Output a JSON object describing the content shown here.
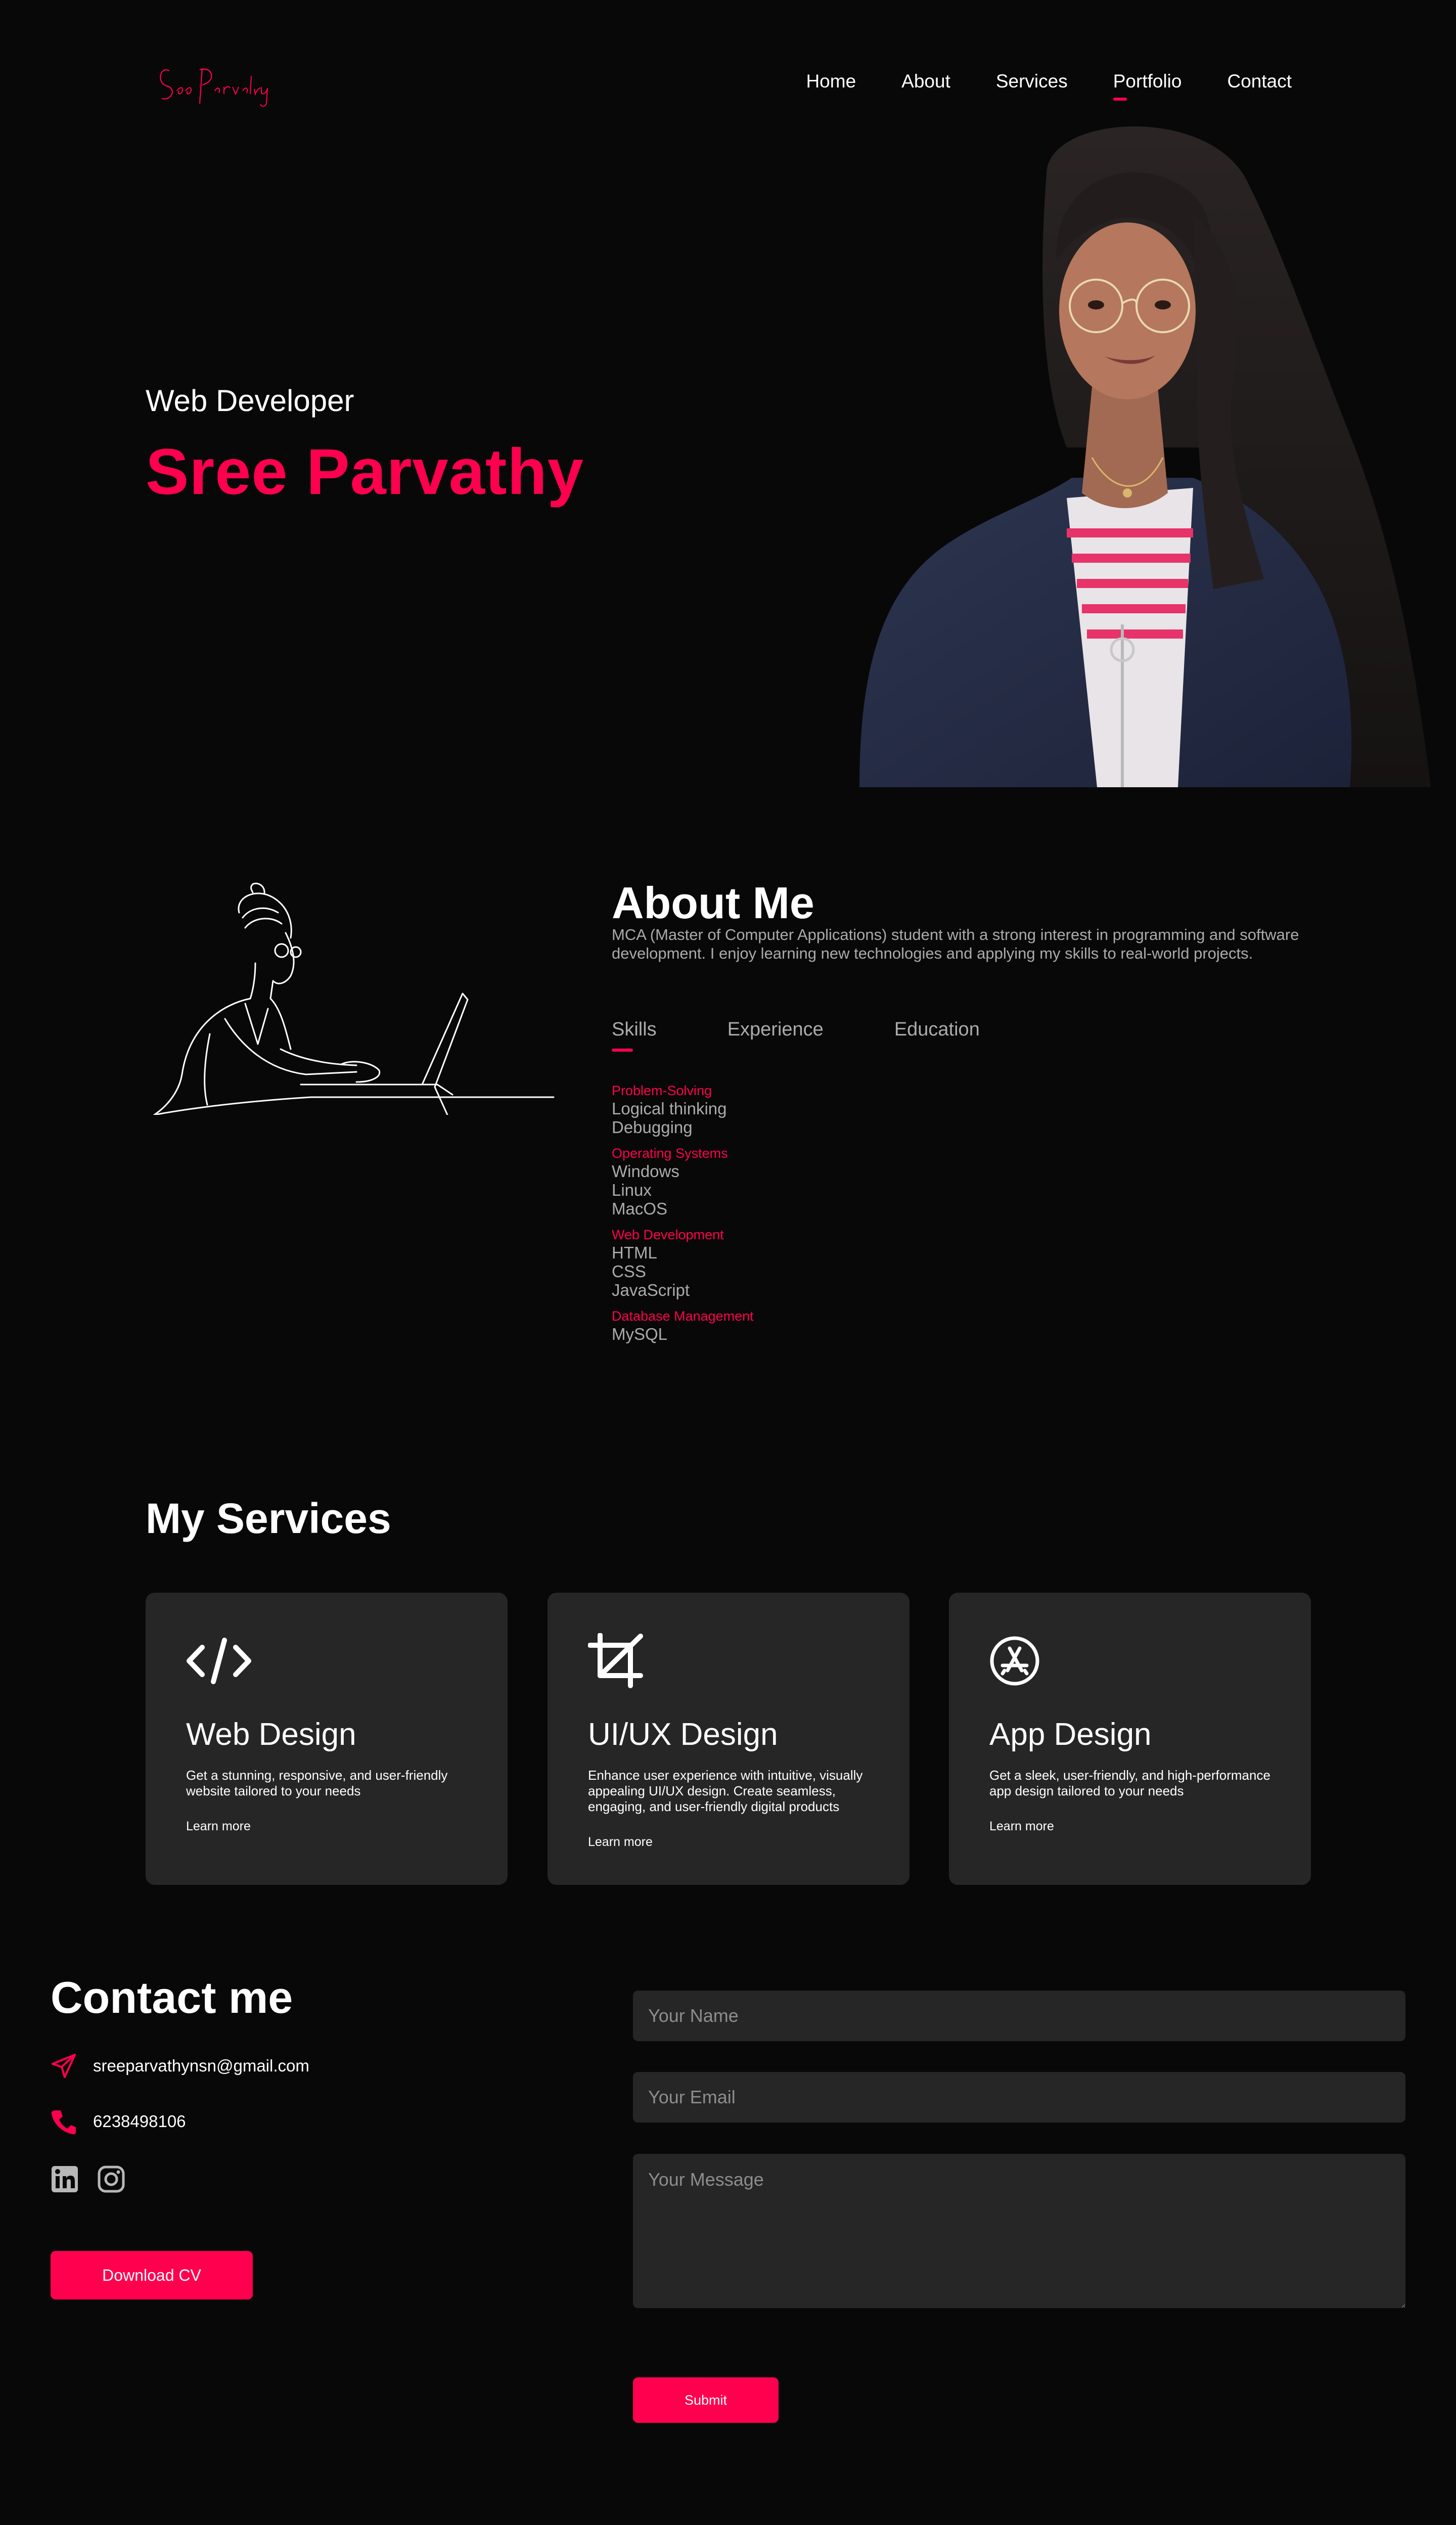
{
  "brand": {
    "logo_text": "Sree Parvathy",
    "accent": "#ff004f",
    "bg": "#080808",
    "card_bg": "#262626"
  },
  "nav": {
    "items": [
      {
        "label": "Home"
      },
      {
        "label": "About"
      },
      {
        "label": "Services"
      },
      {
        "label": "Portfolio",
        "active": true
      },
      {
        "label": "Contact"
      }
    ]
  },
  "hero": {
    "role": "Web Developer",
    "name": "Sree Parvathy",
    "portrait_icon": "portrait-photo"
  },
  "about": {
    "title": "About Me",
    "text": "MCA (Master of Computer Applications) student with a strong interest in programming and software development. I enjoy learning new technologies and applying my skills to real-world projects.",
    "illustration_icon": "woman-at-laptop-line-art",
    "tabs": [
      {
        "label": "Skills",
        "active": true
      },
      {
        "label": "Experience"
      },
      {
        "label": "Education"
      }
    ],
    "skills": [
      {
        "category": "Problem-Solving",
        "items": [
          "Logical thinking",
          "Debugging"
        ]
      },
      {
        "category": "Operating Systems",
        "items": [
          "Windows",
          "Linux",
          "MacOS"
        ]
      },
      {
        "category": "Web Development",
        "items": [
          "HTML",
          "CSS",
          "JavaScript"
        ]
      },
      {
        "category": "Database Management",
        "items": [
          "MySQL"
        ]
      }
    ]
  },
  "services": {
    "title": "My Services",
    "cards": [
      {
        "icon": "code-icon",
        "title": "Web Design",
        "text": "Get a stunning, responsive, and user-friendly website tailored to your needs",
        "link": "Learn more"
      },
      {
        "icon": "crop-icon",
        "title": "UI/UX Design",
        "text": "Enhance user experience with intuitive, visually appealing UI/UX design. Create seamless, engaging, and user-friendly digital products",
        "link": "Learn more"
      },
      {
        "icon": "app-store-icon",
        "title": "App Design",
        "text": "Get a sleek, user-friendly, and high-performance app design tailored to your needs",
        "link": "Learn more"
      }
    ]
  },
  "contact": {
    "title": "Contact me",
    "email": "sreeparvathynsn@gmail.com",
    "phone": "6238498106",
    "social": [
      "linkedin-icon",
      "instagram-icon"
    ],
    "cv_button": "Download CV",
    "form": {
      "name_placeholder": "Your Name",
      "email_placeholder": "Your Email",
      "message_placeholder": "Your Message",
      "submit_label": "Submit"
    }
  }
}
